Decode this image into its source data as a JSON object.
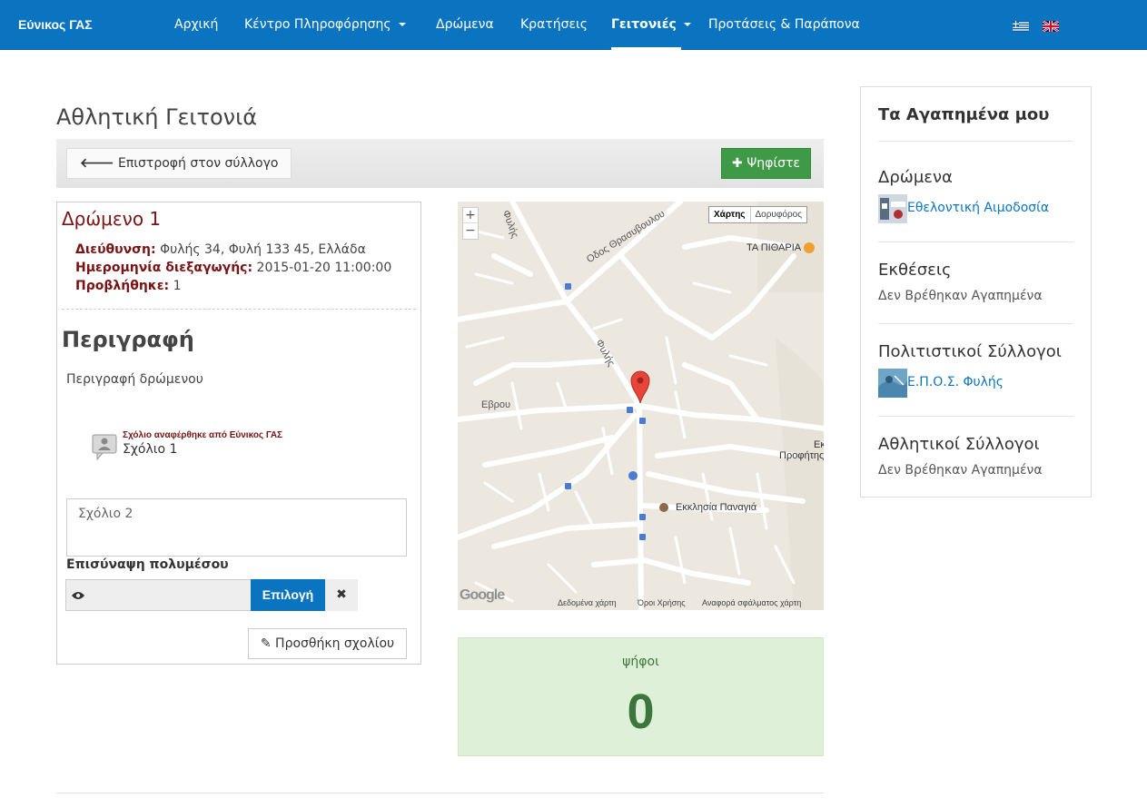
{
  "navbar": {
    "brand": "Εύνικος ΓΑΣ",
    "items": [
      {
        "label": "Αρχική"
      },
      {
        "label": "Κέντρο Πληροφόρησης"
      },
      {
        "label": "Δρώμενα"
      },
      {
        "label": "Κρατήσεις"
      },
      {
        "label": "Γειτονιές"
      },
      {
        "label": "Προτάσεις & Παράπονα"
      }
    ],
    "active_item": "Γειτονιές",
    "colors": {
      "background": "#0b74c1"
    }
  },
  "page": {
    "title": "Αθλητική Γειτονιά",
    "back_button": "Επιστροφή στον σύλλογο",
    "vote_button": "Ψηφίστε"
  },
  "event": {
    "title": "Δρώμενο 1",
    "address_label": "Διεύθυνση:",
    "address": "Φυλής 34, Φυλή 133 45, Ελλάδα",
    "date_label": "Ημερομηνία διεξαγωγής:",
    "date": "2015-01-20 11:00:00",
    "views_label": "Προβλήθηκε:",
    "views": "1",
    "description_heading": "Περιγραφή",
    "description": "Περιγραφή δρώμενου"
  },
  "comments": {
    "items": [
      {
        "author_line": "Σχόλιο αναφέρθηκε από Εύνικος ΓΑΣ",
        "text": "Σχόλιο 1"
      }
    ],
    "input_value": "Σχόλιο 2",
    "attach_label": "Επισύναψη πολυμέσου",
    "choose_button": "Επιλογή",
    "clear_button": "✖",
    "add_button": "Προσθήκη σχολίου"
  },
  "map": {
    "zoom_in": "+",
    "zoom_out": "−",
    "type_map": "Χάρτης",
    "type_satellite": "Δορυφόρος",
    "labels": {
      "fylis_top": "Φυλής",
      "thrasyvoulou": "Οδος Θρασυβουλου",
      "ta_pitharia": "ΤΑ ΠΙΘΑΡΙΑ",
      "fylis_mid": "Φυλής",
      "evrou": "Εβρου",
      "profitis_1": "Εκ",
      "profitis_2": "Προφήτης",
      "ekklisia": "Εκκλησία Παναγιά"
    },
    "google": "Google",
    "footer": {
      "data": "Δεδομένα χάρτη",
      "terms": "Όροι Χρήσης",
      "report": "Αναφορά σφάλματος χάρτη"
    }
  },
  "votes": {
    "label": "ψήφοι",
    "count": "0",
    "colors": {
      "background": "#dff0d8",
      "text": "#3c763d"
    }
  },
  "favorites": {
    "title": "Τα Αγαπημένα μου",
    "sections": [
      {
        "heading": "Δρώμενα",
        "link": "Εθελοντική Αιμοδοσία"
      },
      {
        "heading": "Εκθέσεις",
        "empty": "Δεν Βρέθηκαν Αγαπημένα"
      },
      {
        "heading": "Πολιτιστικοί Σύλλογοι",
        "link": "Ε.Π.Ο.Σ. Φυλής"
      },
      {
        "heading": "Αθλητικοί Σύλλογοι",
        "empty": "Δεν Βρέθηκαν Αγαπημένα"
      }
    ]
  }
}
